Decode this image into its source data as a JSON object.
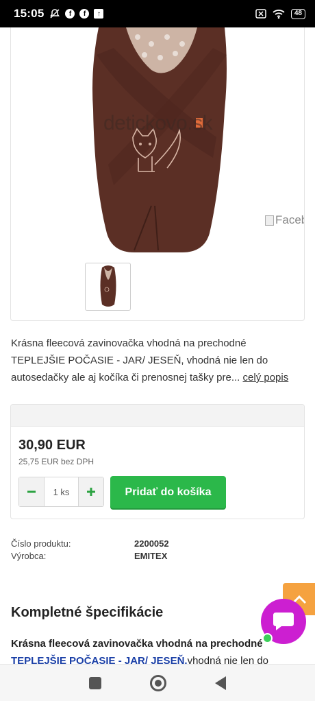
{
  "status_bar": {
    "time": "15:05",
    "battery": "48",
    "icons": [
      "notifications-off-icon",
      "facebook-icon",
      "facebook-icon",
      "upload-icon",
      "sim-off-icon",
      "wifi-icon",
      "battery-icon"
    ]
  },
  "product": {
    "watermark": "detickovo.sk",
    "broken_image_alt": "Facebook",
    "description": "Krásna fleecová zavinovačka vhodná na prechodné TEPLEJŠIE POČASIE - JAR/ JESEŇ, vhodná nie len do autosedačky ale aj kočíka či prenosnej tašky pre...",
    "more_link": "celý popis"
  },
  "purchase": {
    "price": "30,90 EUR",
    "price_net": "25,75 EUR",
    "price_net_suffix": "bez DPH",
    "quantity": "1",
    "quantity_unit": "ks",
    "add_to_cart": "Pridať do košíka"
  },
  "meta": {
    "rows": [
      {
        "label": "Číslo produktu:",
        "value": "2200052"
      },
      {
        "label": "Výrobca:",
        "value": "EMITEX"
      }
    ]
  },
  "specs": {
    "title": "Kompletné špecifikácie",
    "text_bold": "Krásna fleecová zavinovačka vhodná na prechodné",
    "text_blue": "TEPLEJŠIE POČASIE - JAR/ JESEŇ.",
    "text_rest": "vhodná nie len do"
  },
  "colors": {
    "accent_green": "#2bb84a",
    "scroll_top": "#f5a240",
    "chat": "#cc1fd1",
    "product_brown": "#5a2e24"
  }
}
